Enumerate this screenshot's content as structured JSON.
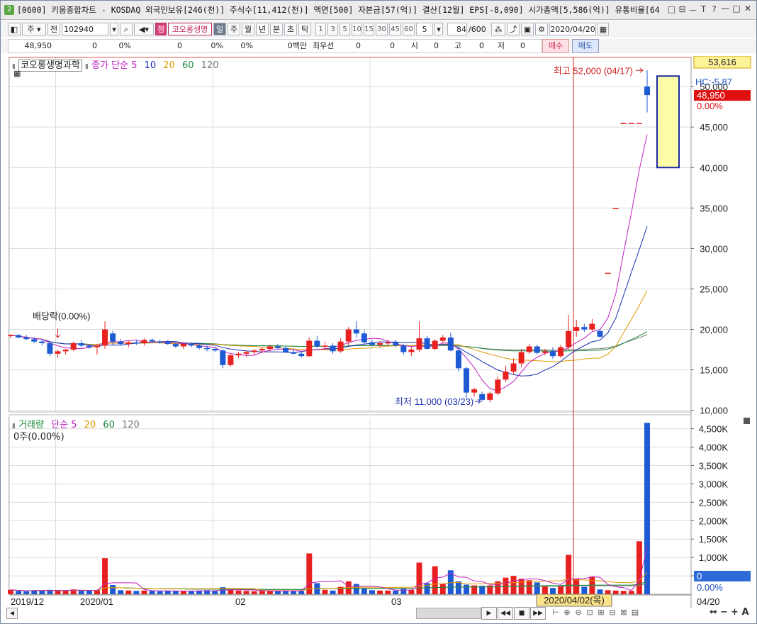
{
  "title": "[0600] 키움종합차트 - KOSDAQ 외국인보유[246(천)] 주식수[11,412(천)] 액면[500] 자본금[57(억)] 결산[12월] EPS[-8,090] 시가총액[5,586(억)] 유통비율[64",
  "window_badge": "2",
  "title_icons": [
    "□",
    "⊟",
    "ᅮ",
    "T",
    "?"
  ],
  "window_controls": [
    "—",
    "□",
    "✕"
  ],
  "toolbar": {
    "period_mode": "주",
    "prev": "전",
    "code": "102940",
    "num_badge": "정",
    "stock_name": "코오롱생명",
    "periods": [
      "일",
      "주",
      "월",
      "년",
      "분",
      "초",
      "틱"
    ],
    "intervals": [
      "1",
      "3",
      "5",
      "10",
      "15",
      "30",
      "45",
      "60"
    ],
    "interval_value": "5",
    "count": "84",
    "count_max": "/600",
    "date": "2020/04/20"
  },
  "quote": {
    "price": "48,950",
    "change": "0",
    "change_pct": "0%",
    "v1": "0",
    "v2": "0%",
    "v3": "0%",
    "vol_amt": "0백만",
    "best_label": "최우선",
    "b1": "0",
    "b2": "0",
    "open_label": "시",
    "open": "0",
    "high_label": "고",
    "high": "0",
    "low_label": "저",
    "low": "0",
    "buy_label": "매수",
    "sell_label": "매도"
  },
  "legend": {
    "stock_name": "코오롱생명과학",
    "close_label": "종가 단순",
    "ma": [
      {
        "p": "5",
        "color": "#c020c0"
      },
      {
        "p": "10",
        "color": "#1a2fb0"
      },
      {
        "p": "20",
        "color": "#e09a00"
      },
      {
        "p": "60",
        "color": "#1a8a3a"
      },
      {
        "p": "120",
        "color": "#777777"
      }
    ],
    "vol_label": "거래량",
    "vol_ma_label": "단순",
    "vol_ma": [
      {
        "p": "5",
        "color": "#c020c0"
      },
      {
        "p": "20",
        "color": "#e09a00"
      },
      {
        "p": "60",
        "color": "#1a8a3a"
      },
      {
        "p": "120",
        "color": "#777777"
      }
    ],
    "vol_value": "0주(0.00%)"
  },
  "annotations": {
    "high": "최고 52,000 (04/17)",
    "low": "최저 11,000 (03/23)",
    "dividend": "배당락(0.00%)",
    "price_box": "53,616",
    "hc": "HC:-5.87",
    "last_price": "48,950",
    "last_pct": "0.00%",
    "vol_last": "0",
    "vol_pct": "0.00%",
    "crosshair_date": "2020/04/02(목)",
    "x_labels": [
      "2019/12",
      "2020/01",
      "02",
      "03",
      "04/20"
    ]
  },
  "colors": {
    "up": "#e82020",
    "down": "#1e5ad4",
    "grid": "#dcdcdc"
  },
  "chart_data": {
    "type": "candlestick",
    "price_ticks": [
      10000,
      15000,
      20000,
      25000,
      30000,
      35000,
      40000,
      45000,
      50000
    ],
    "price_tick_labels": [
      "10,000",
      "15,000",
      "20,000",
      "25,000",
      "30,000",
      "35,000",
      "40,000",
      "45,000",
      "50,000"
    ],
    "ylim": [
      9800,
      53600
    ],
    "volume_ticks": [
      500,
      1000,
      1500,
      2000,
      2500,
      3000,
      3500,
      4000,
      4500
    ],
    "volume_tick_labels": [
      "500K",
      "1,000K",
      "1,500K",
      "2,000K",
      "2,500K",
      "3,000K",
      "3,500K",
      "4,000K",
      "4,500K"
    ],
    "volume_ylim": [
      0,
      4800
    ],
    "candles": [
      [
        19200,
        19400,
        18900,
        19300,
        120
      ],
      [
        19300,
        19450,
        18900,
        19000,
        90
      ],
      [
        19000,
        19300,
        18700,
        18800,
        80
      ],
      [
        18800,
        19000,
        18300,
        18500,
        100
      ],
      [
        18500,
        18800,
        18000,
        18300,
        110
      ],
      [
        18300,
        18400,
        16700,
        17000,
        120
      ],
      [
        17000,
        17500,
        16500,
        17300,
        100
      ],
      [
        17300,
        17600,
        16900,
        17500,
        90
      ],
      [
        17500,
        18500,
        17300,
        18300,
        130
      ],
      [
        18300,
        18700,
        17800,
        18000,
        110
      ],
      [
        18000,
        18200,
        17600,
        17800,
        100
      ],
      [
        17800,
        18200,
        16900,
        18000,
        110
      ],
      [
        18000,
        21000,
        17600,
        20000,
        980
      ],
      [
        19500,
        19800,
        18000,
        18500,
        250
      ],
      [
        18500,
        18800,
        18000,
        18200,
        110
      ],
      [
        18200,
        18600,
        17800,
        18400,
        100
      ],
      [
        18400,
        18700,
        18100,
        18300,
        90
      ],
      [
        18300,
        18900,
        18000,
        18700,
        100
      ],
      [
        18700,
        18900,
        18300,
        18500,
        90
      ],
      [
        18500,
        18700,
        18200,
        18400,
        80
      ],
      [
        18400,
        18700,
        18100,
        18200,
        90
      ],
      [
        18200,
        18400,
        17700,
        17900,
        80
      ],
      [
        17900,
        18400,
        17600,
        18200,
        90
      ],
      [
        18200,
        18400,
        17800,
        18000,
        80
      ],
      [
        18000,
        18200,
        17500,
        17700,
        100
      ],
      [
        17700,
        18000,
        17300,
        17600,
        110
      ],
      [
        17600,
        17800,
        17200,
        17400,
        90
      ],
      [
        17400,
        17600,
        15200,
        15600,
        190
      ],
      [
        15600,
        17000,
        15400,
        16800,
        120
      ],
      [
        16800,
        17200,
        16500,
        17000,
        100
      ],
      [
        17000,
        17400,
        16600,
        17200,
        90
      ],
      [
        17200,
        17600,
        16800,
        17400,
        80
      ],
      [
        17400,
        17800,
        17100,
        17600,
        90
      ],
      [
        17600,
        18100,
        17300,
        17900,
        80
      ],
      [
        17900,
        18200,
        17500,
        17700,
        90
      ],
      [
        17700,
        17900,
        17100,
        17200,
        100
      ],
      [
        17200,
        17500,
        16900,
        17000,
        80
      ],
      [
        17000,
        17300,
        16500,
        16700,
        90
      ],
      [
        16700,
        19000,
        16600,
        18600,
        1110
      ],
      [
        18600,
        19200,
        17700,
        17900,
        300
      ],
      [
        17900,
        18500,
        17500,
        18000,
        120
      ],
      [
        18000,
        18300,
        17000,
        17300,
        100
      ],
      [
        17300,
        18900,
        17100,
        18500,
        200
      ],
      [
        18500,
        20300,
        18000,
        20000,
        350
      ],
      [
        20000,
        21000,
        19000,
        19500,
        280
      ],
      [
        19500,
        19900,
        18200,
        18400,
        150
      ],
      [
        18400,
        18700,
        17900,
        18100,
        110
      ],
      [
        18100,
        18500,
        17800,
        18300,
        100
      ],
      [
        18300,
        18700,
        18000,
        18400,
        100
      ],
      [
        18400,
        18700,
        17800,
        18000,
        100
      ],
      [
        18000,
        18200,
        16900,
        17200,
        150
      ],
      [
        17200,
        17800,
        16700,
        17500,
        120
      ],
      [
        17500,
        21000,
        17200,
        18900,
        860
      ],
      [
        18900,
        19200,
        17500,
        17600,
        300
      ],
      [
        17600,
        18800,
        17400,
        18600,
        760
      ],
      [
        18600,
        19300,
        18300,
        19000,
        280
      ],
      [
        19000,
        19600,
        17300,
        17400,
        650
      ],
      [
        17400,
        17800,
        14800,
        15200,
        350
      ],
      [
        15200,
        15400,
        11500,
        12200,
        260
      ],
      [
        12200,
        12800,
        11700,
        12600,
        240
      ],
      [
        12000,
        12300,
        11100,
        11300,
        230
      ],
      [
        11300,
        12300,
        11000,
        12100,
        240
      ],
      [
        12100,
        14200,
        11900,
        13800,
        350
      ],
      [
        13800,
        15500,
        13500,
        14800,
        450
      ],
      [
        14800,
        16400,
        14400,
        15800,
        500
      ],
      [
        15800,
        17600,
        15300,
        17200,
        420
      ],
      [
        17200,
        18200,
        17000,
        17900,
        380
      ],
      [
        17900,
        18100,
        16900,
        17100,
        320
      ],
      [
        17100,
        17600,
        16800,
        17300,
        220
      ],
      [
        17300,
        17800,
        16400,
        16700,
        170
      ],
      [
        16700,
        18100,
        16500,
        17800,
        240
      ],
      [
        17800,
        21800,
        17500,
        19800,
        1070
      ],
      [
        19800,
        21200,
        19100,
        20300,
        420
      ],
      [
        20300,
        20700,
        19700,
        20000,
        200
      ],
      [
        20000,
        21300,
        19800,
        20700,
        470
      ],
      [
        19800,
        20000,
        18900,
        19100,
        130
      ],
      [
        27000,
        27000,
        27000,
        27000,
        110
      ],
      [
        35000,
        35000,
        35000,
        35000,
        100
      ],
      [
        45500,
        45500,
        45500,
        45500,
        90
      ],
      [
        45500,
        45500,
        45500,
        45500,
        90
      ],
      [
        45500,
        45500,
        45500,
        45500,
        1440
      ],
      [
        50000,
        52000,
        46800,
        48950,
        4660
      ]
    ]
  }
}
